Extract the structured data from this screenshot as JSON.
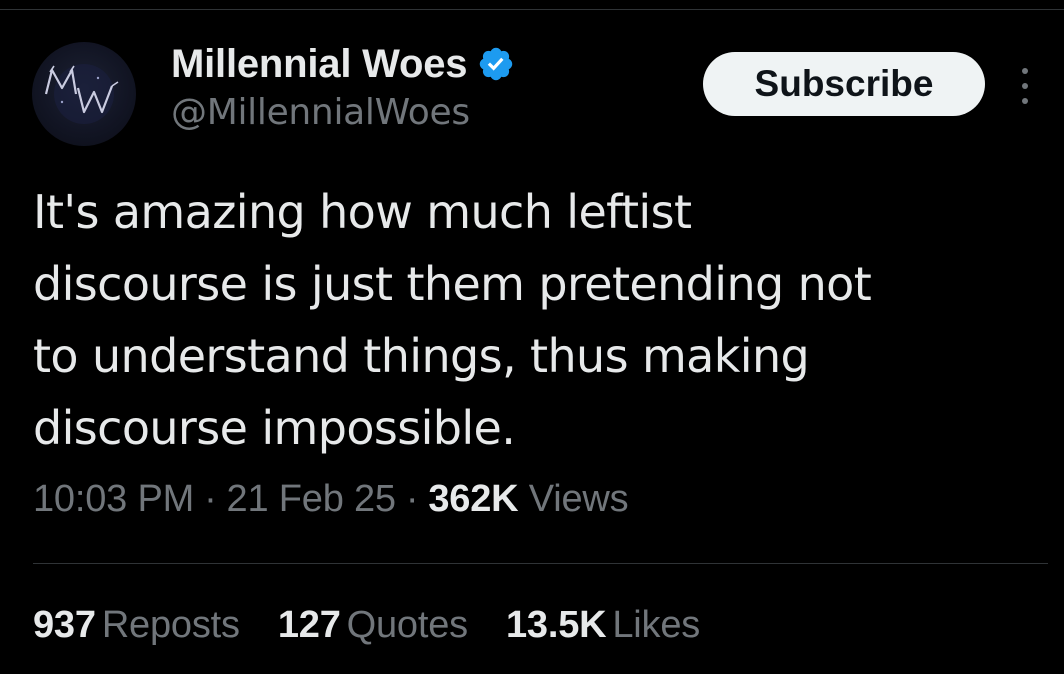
{
  "author": {
    "display_name": "Millennial Woes",
    "handle": "@MillennialWoes",
    "verified": true,
    "avatar_text": "MW"
  },
  "header": {
    "subscribe_label": "Subscribe",
    "more_icon": "more-vertical-icon"
  },
  "tweet": {
    "text": "It's amazing how much leftist\ndiscourse is just them pretending not\nto understand things, thus making\ndiscourse impossible."
  },
  "meta": {
    "time": "10:03 PM",
    "date": "21 Feb 25",
    "views_count": "362K",
    "views_label": "Views"
  },
  "stats": {
    "reposts_count": "937",
    "reposts_label": "Reposts",
    "quotes_count": "127",
    "quotes_label": "Quotes",
    "likes_count": "13.5K",
    "likes_label": "Likes"
  },
  "colors": {
    "background": "#000000",
    "primary_text": "#e7e9ea",
    "secondary_text": "#71767b",
    "verified_blue": "#1d9bf0",
    "button_bg": "#eff3f4",
    "divider": "#2f3336"
  }
}
